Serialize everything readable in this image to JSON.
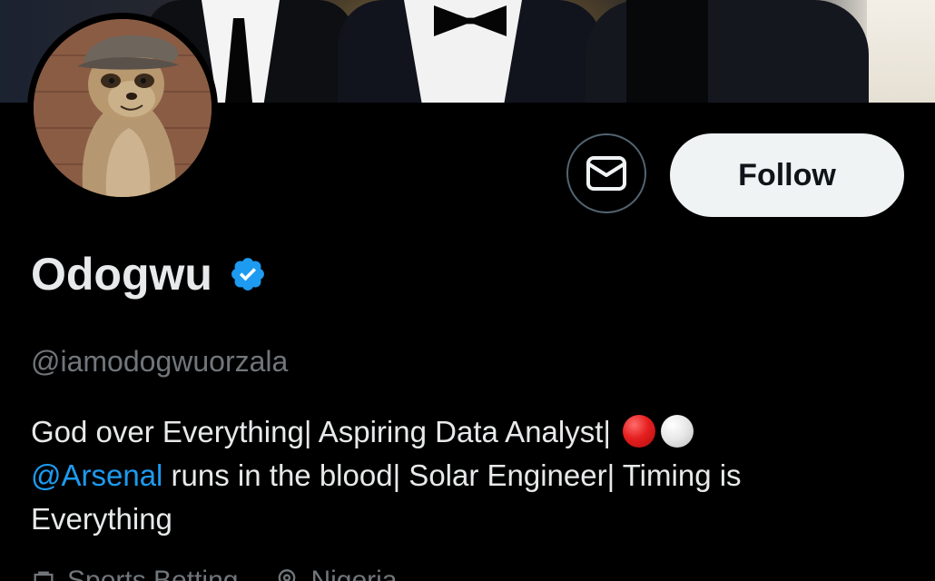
{
  "profile": {
    "name": "Odogwu",
    "handle": "@iamodogwuorzala",
    "verified": true,
    "bio": {
      "line1": "God over Everything| Aspiring Data Analyst| ",
      "mention": "@Arsenal",
      "line2_rest": " runs in the blood| Solar Engineer| Timing is",
      "line3": "Everything"
    },
    "bio_emojis": [
      "red-circle",
      "white-circle"
    ]
  },
  "actions": {
    "follow_label": "Follow",
    "message_icon": "envelope-icon"
  },
  "meta": {
    "category": "Sports Betting",
    "location": "Nigeria"
  },
  "colors": {
    "background": "#000000",
    "text_primary": "#e7e9ea",
    "text_secondary": "#71767b",
    "accent": "#1d9bf0",
    "follow_bg": "#eff3f4"
  }
}
